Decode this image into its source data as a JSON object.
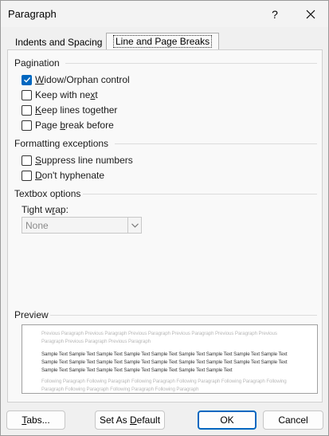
{
  "window": {
    "title": "Paragraph",
    "help_label": "?"
  },
  "tabs": [
    {
      "label": "Indents and Spacing",
      "active": false
    },
    {
      "label": "Line and Page Breaks",
      "active": true
    }
  ],
  "pagination": {
    "heading": "Pagination",
    "items": [
      {
        "pre": "",
        "key": "W",
        "post": "idow/Orphan control",
        "checked": true
      },
      {
        "pre": "Keep with ne",
        "key": "x",
        "post": "t",
        "checked": false
      },
      {
        "pre": "",
        "key": "K",
        "post": "eep lines together",
        "checked": false
      },
      {
        "pre": "Page ",
        "key": "b",
        "post": "reak before",
        "checked": false
      }
    ]
  },
  "formatting": {
    "heading": "Formatting exceptions",
    "items": [
      {
        "pre": "",
        "key": "S",
        "post": "uppress line numbers",
        "checked": false
      },
      {
        "pre": "",
        "key": "D",
        "post": "on't hyphenate",
        "checked": false
      }
    ]
  },
  "textbox": {
    "heading": "Textbox options",
    "tight_wrap_pre": "Tight w",
    "tight_wrap_key": "r",
    "tight_wrap_post": "ap:",
    "tight_wrap_value": "None"
  },
  "preview": {
    "heading": "Preview",
    "previous_text": "Previous Paragraph Previous Paragraph Previous Paragraph Previous Paragraph Previous Paragraph Previous Paragraph Previous Paragraph Previous Paragraph",
    "sample_text": "Sample Text Sample Text Sample Text Sample Text Sample Text Sample Text Sample Text Sample Text Sample Text Sample Text Sample Text Sample Text Sample Text Sample Text Sample Text Sample Text Sample Text Sample Text Sample Text Sample Text Sample Text Sample Text Sample Text Sample Text Sample Text",
    "following_text": "Following Paragraph Following Paragraph Following Paragraph Following Paragraph Following Paragraph Following Paragraph Following Paragraph Following Paragraph Following Paragraph"
  },
  "buttons": {
    "tabs_key": "T",
    "tabs_rest": "abs...",
    "set_default_pre": "Set As ",
    "set_default_key": "D",
    "set_default_post": "efault",
    "ok": "OK",
    "cancel": "Cancel"
  },
  "colors": {
    "accent": "#0067c0",
    "dialog_bg": "#f0f0f0"
  },
  "icons": {
    "close": "close-icon",
    "check": "check-icon",
    "dropdown": "chevron-down-icon"
  }
}
